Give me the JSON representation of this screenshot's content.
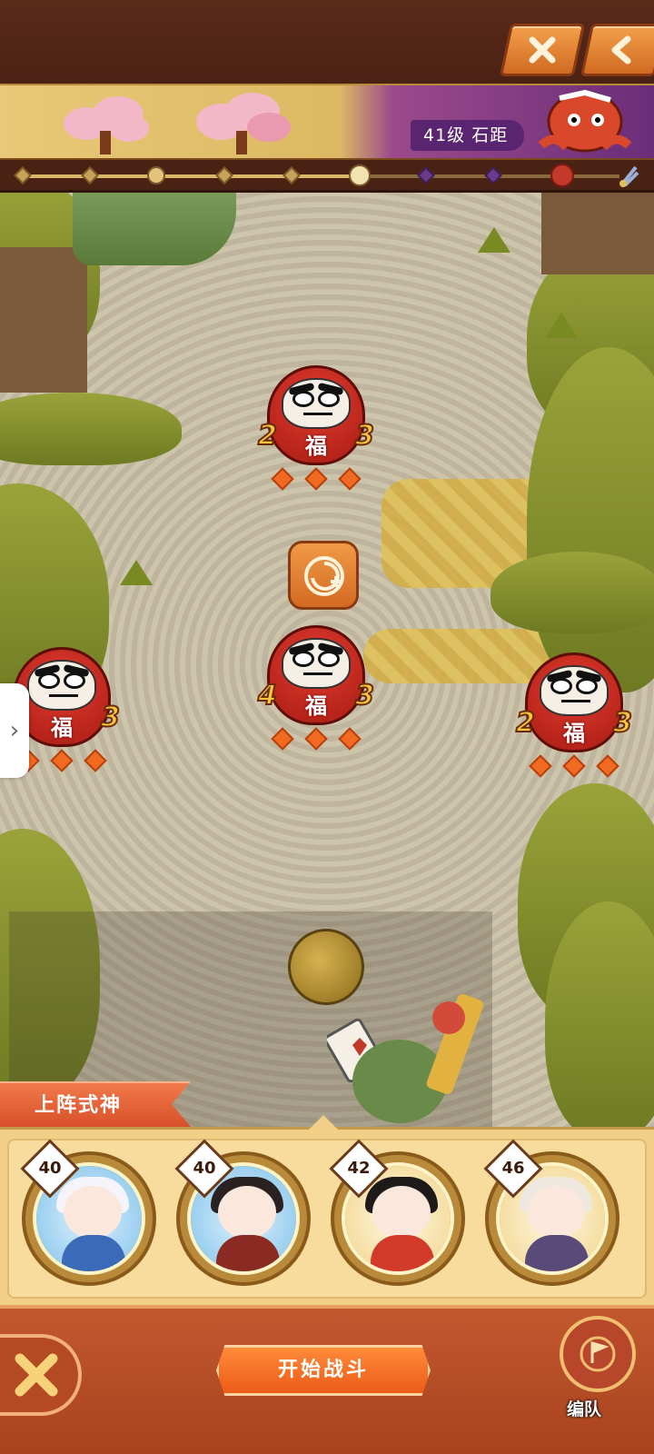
{
  "stage": {
    "level_text": "41级 石距"
  },
  "progress": {
    "nodes": [
      "step",
      "step",
      "chest",
      "step",
      "step",
      "current",
      "purple",
      "purple",
      "boss"
    ],
    "current_index": 5
  },
  "enemies": [
    {
      "left_num": "2",
      "right_num": "3",
      "char": "福",
      "stars": 3
    },
    {
      "left_num": "4",
      "right_num": "3",
      "char": "福",
      "stars": 3
    },
    {
      "left_num": "",
      "right_num": "3",
      "char": "福",
      "stars": 3
    },
    {
      "left_num": "2",
      "right_num": "3",
      "char": "福",
      "stars": 3
    }
  ],
  "roster": {
    "section_label": "上阵式神",
    "shikigami": [
      {
        "level": "40",
        "color": "#9fd4f0"
      },
      {
        "level": "40",
        "color": "#3a2a2a"
      },
      {
        "level": "42",
        "color": "#d23a2a"
      },
      {
        "level": "46",
        "color": "#e8e0d8"
      }
    ]
  },
  "actions": {
    "start_label": "开始战斗",
    "formation_label": "编队"
  },
  "colors": {
    "accent": "#ec5c18",
    "banner_purple": "#5a2570",
    "daruma_red": "#c42a1e"
  }
}
